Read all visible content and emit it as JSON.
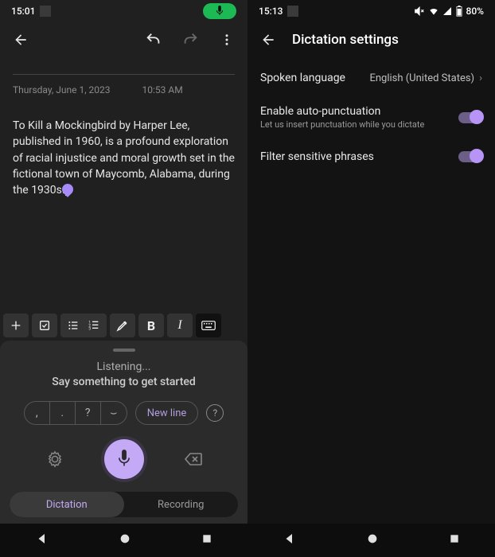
{
  "left": {
    "status": {
      "time": "15:01"
    },
    "note": {
      "date": "Thursday, June 1, 2023",
      "time": "10:53 AM",
      "text": "To Kill a Mockingbird by Harper Lee, published in 1960, is a profound exploration of racial injustice and moral growth set in the fictional town of Maycomb, Alabama, during the 1930s."
    },
    "dictation": {
      "listening": "Listening...",
      "hint": "Say something to get started",
      "punct": {
        "comma": ",",
        "period": ".",
        "qmark": "?",
        "space": "⌣"
      },
      "newline": "New line",
      "tabs": {
        "dictation": "Dictation",
        "recording": "Recording"
      }
    }
  },
  "right": {
    "status": {
      "time": "15:13",
      "battery": "80%"
    },
    "header": {
      "title": "Dictation settings"
    },
    "rows": {
      "lang": {
        "label": "Spoken language",
        "value": "English (United States)"
      },
      "autopunct": {
        "label": "Enable auto-punctuation",
        "sub": "Let us insert punctuation while you dictate"
      },
      "filter": {
        "label": "Filter sensitive phrases"
      }
    }
  }
}
